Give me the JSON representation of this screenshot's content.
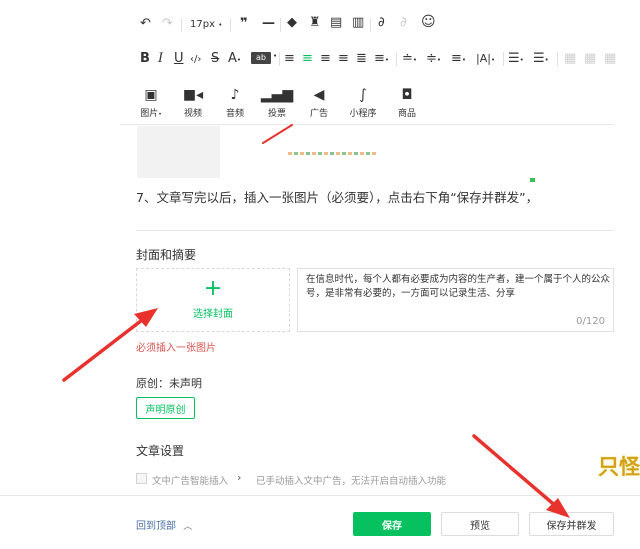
{
  "toolbar": {
    "font_size": "17px",
    "media": [
      {
        "label": "图片",
        "icon": "image-icon"
      },
      {
        "label": "视频",
        "icon": "video-icon"
      },
      {
        "label": "音频",
        "icon": "microphone-icon"
      },
      {
        "label": "投票",
        "icon": "vote-icon"
      },
      {
        "label": "广告",
        "icon": "megaphone-icon"
      },
      {
        "label": "小程序",
        "icon": "mini-program-icon"
      },
      {
        "label": "商品",
        "icon": "shopping-bag-icon"
      }
    ]
  },
  "editor": {
    "paragraph": "7、文章写完以后，插入一张图片（必须要），点击右下角“保存并群发”，"
  },
  "cover": {
    "section_title": "封面和摘要",
    "select_label": "选择封面",
    "required_note": "必须插入一张图片",
    "summary_text": "在信息时代，每个人都有必要成为内容的生产者，建一个属于个人的公众号，是非常有必要的，一方面可以记录生活、分享",
    "char_count": "0/120"
  },
  "original": {
    "status": "原创：未声明",
    "declare_button": "声明原创"
  },
  "settings": {
    "title": "文章设置",
    "ad_checkbox_label": "文中广告智能插入",
    "ad_hint": "已手动插入文中广告，无法开启自动插入功能"
  },
  "footer": {
    "back_to_top": "回到顶部",
    "save": "保存",
    "preview": "预览",
    "save_and_send": "保存并群发"
  },
  "watermark": "只怪",
  "colors": {
    "accent_green": "#07c160",
    "arrow_red": "#e8322e",
    "required_red": "#d9534f"
  }
}
